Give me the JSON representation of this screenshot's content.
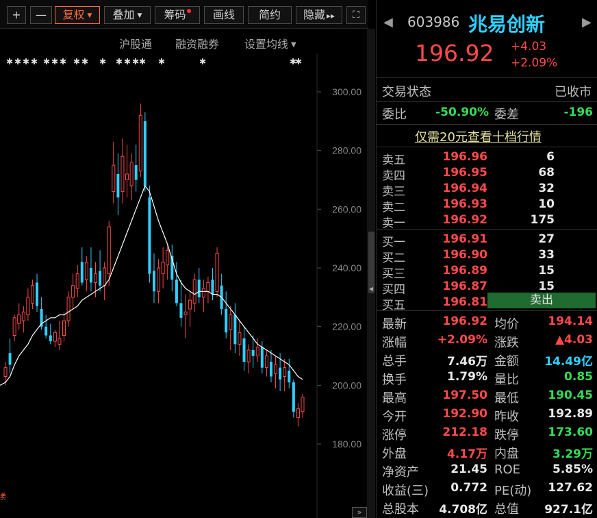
{
  "toolbar": {
    "plus": "+",
    "minus": "—",
    "fuquan": "复权",
    "diejia": "叠加",
    "chouma": "筹码",
    "huaxian": "画线",
    "jianyue": "简约",
    "yincang": "隐藏",
    "yincang_arrows": "▸▸",
    "fullscreen": "⛶"
  },
  "subbar": {
    "hugutong": "沪股通",
    "rongzi": "融资融券",
    "junxian": "设置均线"
  },
  "chart_data": {
    "type": "candlestick",
    "y_ticks": [
      "300.00",
      "280.00",
      "260.00",
      "240.00",
      "220.00",
      "200.00",
      "180.00"
    ],
    "y_values": [
      300,
      280,
      260,
      240,
      220,
      200,
      180
    ],
    "ylim": [
      175,
      307
    ],
    "grid": false,
    "up_color": "#ff4a4a",
    "down_color": "#2fd0ff",
    "ma_color": "#ffffff",
    "candles": [
      {
        "o": 203,
        "h": 208,
        "l": 200,
        "c": 206
      },
      {
        "o": 211,
        "h": 216,
        "l": 204,
        "c": 207
      },
      {
        "o": 217,
        "h": 224,
        "l": 215,
        "c": 223
      },
      {
        "o": 221,
        "h": 228,
        "l": 219,
        "c": 224
      },
      {
        "o": 222,
        "h": 227,
        "l": 218,
        "c": 225
      },
      {
        "o": 224,
        "h": 233,
        "l": 222,
        "c": 230
      },
      {
        "o": 228,
        "h": 236,
        "l": 226,
        "c": 234
      },
      {
        "o": 235,
        "h": 238,
        "l": 225,
        "c": 227
      },
      {
        "o": 226,
        "h": 230,
        "l": 219,
        "c": 220
      },
      {
        "o": 220,
        "h": 224,
        "l": 216,
        "c": 217
      },
      {
        "o": 217,
        "h": 221,
        "l": 214,
        "c": 215
      },
      {
        "o": 215,
        "h": 219,
        "l": 213,
        "c": 218
      },
      {
        "o": 214,
        "h": 222,
        "l": 212,
        "c": 216
      },
      {
        "o": 217,
        "h": 225,
        "l": 215,
        "c": 222
      },
      {
        "o": 222,
        "h": 232,
        "l": 220,
        "c": 230
      },
      {
        "o": 230,
        "h": 238,
        "l": 226,
        "c": 234
      },
      {
        "o": 233,
        "h": 241,
        "l": 230,
        "c": 238
      },
      {
        "o": 242,
        "h": 247,
        "l": 234,
        "c": 235
      },
      {
        "o": 236,
        "h": 244,
        "l": 232,
        "c": 242
      },
      {
        "o": 240,
        "h": 247,
        "l": 232,
        "c": 235
      },
      {
        "o": 235,
        "h": 242,
        "l": 230,
        "c": 238
      },
      {
        "o": 239,
        "h": 246,
        "l": 232,
        "c": 234
      },
      {
        "o": 234,
        "h": 242,
        "l": 229,
        "c": 240
      },
      {
        "o": 238,
        "h": 256,
        "l": 234,
        "c": 254
      },
      {
        "o": 266,
        "h": 283,
        "l": 262,
        "c": 275
      },
      {
        "o": 272,
        "h": 279,
        "l": 258,
        "c": 264
      },
      {
        "o": 266,
        "h": 284,
        "l": 262,
        "c": 278
      },
      {
        "o": 270,
        "h": 282,
        "l": 264,
        "c": 272
      },
      {
        "o": 268,
        "h": 279,
        "l": 263,
        "c": 276
      },
      {
        "o": 275,
        "h": 282,
        "l": 266,
        "c": 270
      },
      {
        "o": 273,
        "h": 296,
        "l": 271,
        "c": 292
      },
      {
        "o": 290,
        "h": 293,
        "l": 266,
        "c": 268
      },
      {
        "o": 264,
        "h": 268,
        "l": 235,
        "c": 238
      },
      {
        "o": 239,
        "h": 245,
        "l": 228,
        "c": 232
      },
      {
        "o": 232,
        "h": 243,
        "l": 228,
        "c": 240
      },
      {
        "o": 238,
        "h": 247,
        "l": 233,
        "c": 242
      },
      {
        "o": 241,
        "h": 248,
        "l": 236,
        "c": 246
      },
      {
        "o": 244,
        "h": 248,
        "l": 232,
        "c": 236
      },
      {
        "o": 236,
        "h": 242,
        "l": 227,
        "c": 228
      },
      {
        "o": 228,
        "h": 236,
        "l": 220,
        "c": 223
      },
      {
        "o": 224,
        "h": 231,
        "l": 216,
        "c": 225
      },
      {
        "o": 226,
        "h": 232,
        "l": 220,
        "c": 229
      },
      {
        "o": 228,
        "h": 238,
        "l": 225,
        "c": 236
      },
      {
        "o": 236,
        "h": 240,
        "l": 228,
        "c": 230
      },
      {
        "o": 230,
        "h": 236,
        "l": 225,
        "c": 233
      },
      {
        "o": 232,
        "h": 237,
        "l": 228,
        "c": 235
      },
      {
        "o": 236,
        "h": 240,
        "l": 229,
        "c": 231
      },
      {
        "o": 232,
        "h": 247,
        "l": 230,
        "c": 245
      },
      {
        "o": 234,
        "h": 238,
        "l": 224,
        "c": 226
      },
      {
        "o": 226,
        "h": 232,
        "l": 216,
        "c": 218
      },
      {
        "o": 219,
        "h": 227,
        "l": 212,
        "c": 224
      },
      {
        "o": 224,
        "h": 228,
        "l": 211,
        "c": 214
      },
      {
        "o": 214,
        "h": 222,
        "l": 210,
        "c": 218
      },
      {
        "o": 216,
        "h": 220,
        "l": 205,
        "c": 208
      },
      {
        "o": 208,
        "h": 214,
        "l": 204,
        "c": 212
      },
      {
        "o": 212,
        "h": 217,
        "l": 206,
        "c": 210
      },
      {
        "o": 210,
        "h": 216,
        "l": 208,
        "c": 213
      },
      {
        "o": 213,
        "h": 215,
        "l": 204,
        "c": 206
      },
      {
        "o": 206,
        "h": 212,
        "l": 203,
        "c": 210
      },
      {
        "o": 208,
        "h": 212,
        "l": 201,
        "c": 203
      },
      {
        "o": 204,
        "h": 210,
        "l": 199,
        "c": 207
      },
      {
        "o": 206,
        "h": 211,
        "l": 198,
        "c": 202
      },
      {
        "o": 203,
        "h": 209,
        "l": 198,
        "c": 206
      },
      {
        "o": 205,
        "h": 209,
        "l": 199,
        "c": 201
      },
      {
        "o": 201,
        "h": 202,
        "l": 189,
        "c": 191
      },
      {
        "o": 189,
        "h": 194,
        "l": 186,
        "c": 192
      },
      {
        "o": 191,
        "h": 197,
        "l": 189,
        "c": 196
      }
    ],
    "ma": [
      201,
      203,
      207,
      210,
      212,
      214,
      217,
      219,
      221,
      222,
      223,
      223,
      224,
      224,
      225,
      226,
      227,
      229,
      230,
      231,
      232,
      233,
      234,
      236,
      240,
      244,
      248,
      252,
      256,
      260,
      264,
      268,
      266,
      261,
      256,
      252,
      248,
      243,
      238,
      235,
      233,
      232,
      231,
      232,
      232,
      232,
      231,
      231,
      230,
      228,
      226,
      224,
      222,
      220,
      218,
      216,
      214,
      213,
      212,
      211,
      210,
      209,
      208,
      207,
      205,
      203,
      202
    ]
  },
  "quote": {
    "code": "603986",
    "name": "兆易创新",
    "price": "196.92",
    "change": "+4.03",
    "change_pct": "+2.09%",
    "trade_status_label": "交易状态",
    "trade_status": "已收市",
    "weibi_label": "委比",
    "weibi": "-50.90%",
    "weicha_label": "委差",
    "weicha": "-196",
    "promo": "仅需20元查看十档行情",
    "asks": [
      {
        "label": "卖五",
        "price": "196.96",
        "vol": "6"
      },
      {
        "label": "卖四",
        "price": "196.95",
        "vol": "68"
      },
      {
        "label": "卖三",
        "price": "196.94",
        "vol": "32"
      },
      {
        "label": "卖二",
        "price": "196.93",
        "vol": "10"
      },
      {
        "label": "卖一",
        "price": "196.92",
        "vol": "175"
      }
    ],
    "bids": [
      {
        "label": "买一",
        "price": "196.91",
        "vol": "27"
      },
      {
        "label": "买二",
        "price": "196.90",
        "vol": "33"
      },
      {
        "label": "买三",
        "price": "196.89",
        "vol": "15"
      },
      {
        "label": "买四",
        "price": "196.87",
        "vol": "15"
      },
      {
        "label": "买五",
        "price": "196.81",
        "vol": ""
      }
    ],
    "sell_button": "卖出",
    "stats": [
      {
        "l1": "最新",
        "v1": "196.92",
        "c1": "red",
        "l2": "均价",
        "v2": "194.14",
        "c2": "red"
      },
      {
        "l1": "涨幅",
        "v1": "+2.09%",
        "c1": "red",
        "l2": "涨跌",
        "v2": "▲4.03",
        "c2": "red"
      },
      {
        "l1": "总手",
        "v1": "7.46万",
        "c1": "wht",
        "l2": "金额",
        "v2": "14.49亿",
        "c2": "cyn"
      },
      {
        "l1": "换手",
        "v1": "1.79%",
        "c1": "wht",
        "l2": "量比",
        "v2": "0.85",
        "c2": "grn"
      },
      {
        "l1": "最高",
        "v1": "197.50",
        "c1": "red",
        "l2": "最低",
        "v2": "190.45",
        "c2": "grn"
      },
      {
        "l1": "今开",
        "v1": "192.90",
        "c1": "red",
        "l2": "昨收",
        "v2": "192.89",
        "c2": "wht"
      },
      {
        "l1": "涨停",
        "v1": "212.18",
        "c1": "red",
        "l2": "跌停",
        "v2": "173.60",
        "c2": "grn"
      },
      {
        "l1": "外盘",
        "v1": "4.17万",
        "c1": "red",
        "l2": "内盘",
        "v2": "3.29万",
        "c2": "grn"
      },
      {
        "l1": "净资产",
        "v1": "21.45",
        "c1": "wht",
        "l2": "ROE",
        "v2": "5.85%",
        "c2": "wht"
      },
      {
        "l1": "收益(三)",
        "v1": "0.772",
        "c1": "wht",
        "l2": "PE(动)",
        "v2": "127.62",
        "c2": "wht"
      },
      {
        "l1": "总股本",
        "v1": "4.708亿",
        "c1": "wht",
        "l2": "总值",
        "v2": "927.1亿",
        "c2": "wht"
      }
    ]
  },
  "chrome": {
    "prev_arrow": "◀",
    "next_arrow": "▶",
    "scroll_arrow": "◂",
    "corner_btn": "»",
    "corner_tag": "券"
  }
}
